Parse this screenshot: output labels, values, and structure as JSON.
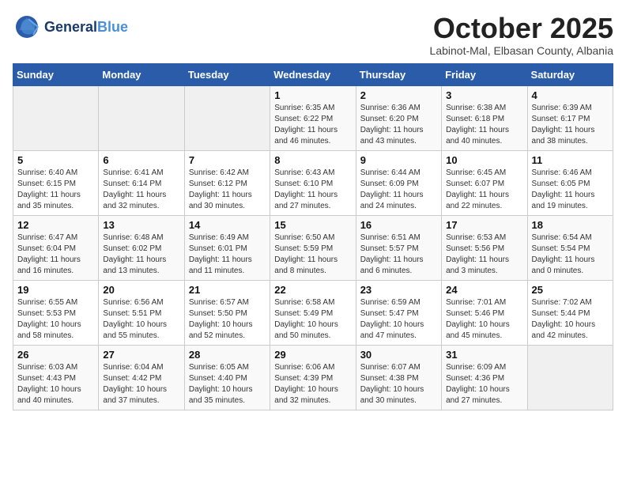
{
  "logo": {
    "line1": "General",
    "line2": "Blue"
  },
  "title": "October 2025",
  "location": "Labinot-Mal, Elbasan County, Albania",
  "weekdays": [
    "Sunday",
    "Monday",
    "Tuesday",
    "Wednesday",
    "Thursday",
    "Friday",
    "Saturday"
  ],
  "weeks": [
    [
      {
        "day": "",
        "info": ""
      },
      {
        "day": "",
        "info": ""
      },
      {
        "day": "",
        "info": ""
      },
      {
        "day": "1",
        "info": "Sunrise: 6:35 AM\nSunset: 6:22 PM\nDaylight: 11 hours\nand 46 minutes."
      },
      {
        "day": "2",
        "info": "Sunrise: 6:36 AM\nSunset: 6:20 PM\nDaylight: 11 hours\nand 43 minutes."
      },
      {
        "day": "3",
        "info": "Sunrise: 6:38 AM\nSunset: 6:18 PM\nDaylight: 11 hours\nand 40 minutes."
      },
      {
        "day": "4",
        "info": "Sunrise: 6:39 AM\nSunset: 6:17 PM\nDaylight: 11 hours\nand 38 minutes."
      }
    ],
    [
      {
        "day": "5",
        "info": "Sunrise: 6:40 AM\nSunset: 6:15 PM\nDaylight: 11 hours\nand 35 minutes."
      },
      {
        "day": "6",
        "info": "Sunrise: 6:41 AM\nSunset: 6:14 PM\nDaylight: 11 hours\nand 32 minutes."
      },
      {
        "day": "7",
        "info": "Sunrise: 6:42 AM\nSunset: 6:12 PM\nDaylight: 11 hours\nand 30 minutes."
      },
      {
        "day": "8",
        "info": "Sunrise: 6:43 AM\nSunset: 6:10 PM\nDaylight: 11 hours\nand 27 minutes."
      },
      {
        "day": "9",
        "info": "Sunrise: 6:44 AM\nSunset: 6:09 PM\nDaylight: 11 hours\nand 24 minutes."
      },
      {
        "day": "10",
        "info": "Sunrise: 6:45 AM\nSunset: 6:07 PM\nDaylight: 11 hours\nand 22 minutes."
      },
      {
        "day": "11",
        "info": "Sunrise: 6:46 AM\nSunset: 6:05 PM\nDaylight: 11 hours\nand 19 minutes."
      }
    ],
    [
      {
        "day": "12",
        "info": "Sunrise: 6:47 AM\nSunset: 6:04 PM\nDaylight: 11 hours\nand 16 minutes."
      },
      {
        "day": "13",
        "info": "Sunrise: 6:48 AM\nSunset: 6:02 PM\nDaylight: 11 hours\nand 13 minutes."
      },
      {
        "day": "14",
        "info": "Sunrise: 6:49 AM\nSunset: 6:01 PM\nDaylight: 11 hours\nand 11 minutes."
      },
      {
        "day": "15",
        "info": "Sunrise: 6:50 AM\nSunset: 5:59 PM\nDaylight: 11 hours\nand 8 minutes."
      },
      {
        "day": "16",
        "info": "Sunrise: 6:51 AM\nSunset: 5:57 PM\nDaylight: 11 hours\nand 6 minutes."
      },
      {
        "day": "17",
        "info": "Sunrise: 6:53 AM\nSunset: 5:56 PM\nDaylight: 11 hours\nand 3 minutes."
      },
      {
        "day": "18",
        "info": "Sunrise: 6:54 AM\nSunset: 5:54 PM\nDaylight: 11 hours\nand 0 minutes."
      }
    ],
    [
      {
        "day": "19",
        "info": "Sunrise: 6:55 AM\nSunset: 5:53 PM\nDaylight: 10 hours\nand 58 minutes."
      },
      {
        "day": "20",
        "info": "Sunrise: 6:56 AM\nSunset: 5:51 PM\nDaylight: 10 hours\nand 55 minutes."
      },
      {
        "day": "21",
        "info": "Sunrise: 6:57 AM\nSunset: 5:50 PM\nDaylight: 10 hours\nand 52 minutes."
      },
      {
        "day": "22",
        "info": "Sunrise: 6:58 AM\nSunset: 5:49 PM\nDaylight: 10 hours\nand 50 minutes."
      },
      {
        "day": "23",
        "info": "Sunrise: 6:59 AM\nSunset: 5:47 PM\nDaylight: 10 hours\nand 47 minutes."
      },
      {
        "day": "24",
        "info": "Sunrise: 7:01 AM\nSunset: 5:46 PM\nDaylight: 10 hours\nand 45 minutes."
      },
      {
        "day": "25",
        "info": "Sunrise: 7:02 AM\nSunset: 5:44 PM\nDaylight: 10 hours\nand 42 minutes."
      }
    ],
    [
      {
        "day": "26",
        "info": "Sunrise: 6:03 AM\nSunset: 4:43 PM\nDaylight: 10 hours\nand 40 minutes."
      },
      {
        "day": "27",
        "info": "Sunrise: 6:04 AM\nSunset: 4:42 PM\nDaylight: 10 hours\nand 37 minutes."
      },
      {
        "day": "28",
        "info": "Sunrise: 6:05 AM\nSunset: 4:40 PM\nDaylight: 10 hours\nand 35 minutes."
      },
      {
        "day": "29",
        "info": "Sunrise: 6:06 AM\nSunset: 4:39 PM\nDaylight: 10 hours\nand 32 minutes."
      },
      {
        "day": "30",
        "info": "Sunrise: 6:07 AM\nSunset: 4:38 PM\nDaylight: 10 hours\nand 30 minutes."
      },
      {
        "day": "31",
        "info": "Sunrise: 6:09 AM\nSunset: 4:36 PM\nDaylight: 10 hours\nand 27 minutes."
      },
      {
        "day": "",
        "info": ""
      }
    ]
  ]
}
